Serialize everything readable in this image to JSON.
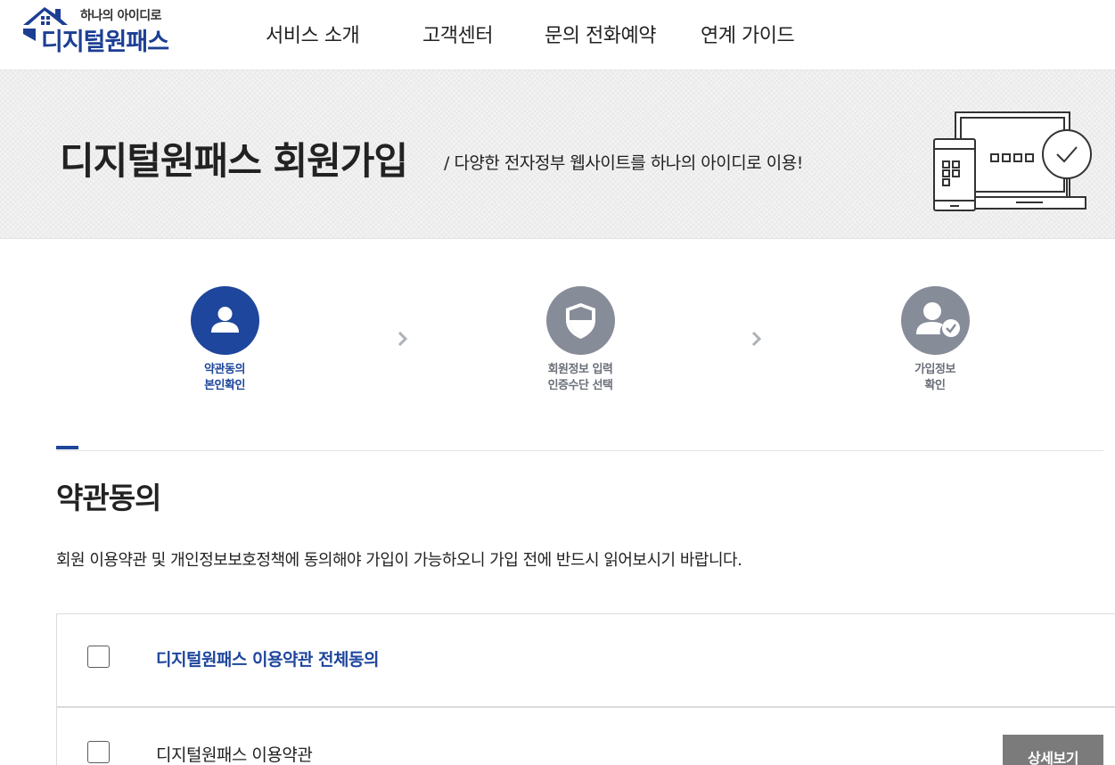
{
  "header": {
    "logo_tagline": "하나의 아이디로",
    "logo_name": "디지털원패스",
    "nav": [
      "서비스 소개",
      "고객센터",
      "문의 전화예약",
      "연계 가이드"
    ]
  },
  "banner": {
    "title": "디지털원패스 회원가입",
    "subtitle": "/ 다양한 전자정부 웹사이트를 하나의 아이디로 이용!"
  },
  "steps": [
    {
      "label": "약관동의\n본인확인",
      "icon": "user-icon",
      "state": "active"
    },
    {
      "label": "회원정보 입력\n인증수단 선택",
      "icon": "shield-icon",
      "state": "inactive"
    },
    {
      "label": "가입정보\n확인",
      "icon": "user-check-icon",
      "state": "inactive"
    }
  ],
  "section": {
    "title": "약관동의",
    "description": "회원 이용약관 및 개인정보보호정책에 동의해야 가입이 가능하오니 가입 전에 반드시 읽어보시기 바랍니다."
  },
  "agreements": {
    "all_label": "디지털원패스 이용약관 전체동의",
    "items": [
      {
        "label": "디지털원패스 이용약관",
        "button": "상세보기"
      }
    ]
  },
  "colors": {
    "primary": "#1e469c",
    "inactive_step": "#878c99",
    "detail_button": "#7b7b7b"
  }
}
